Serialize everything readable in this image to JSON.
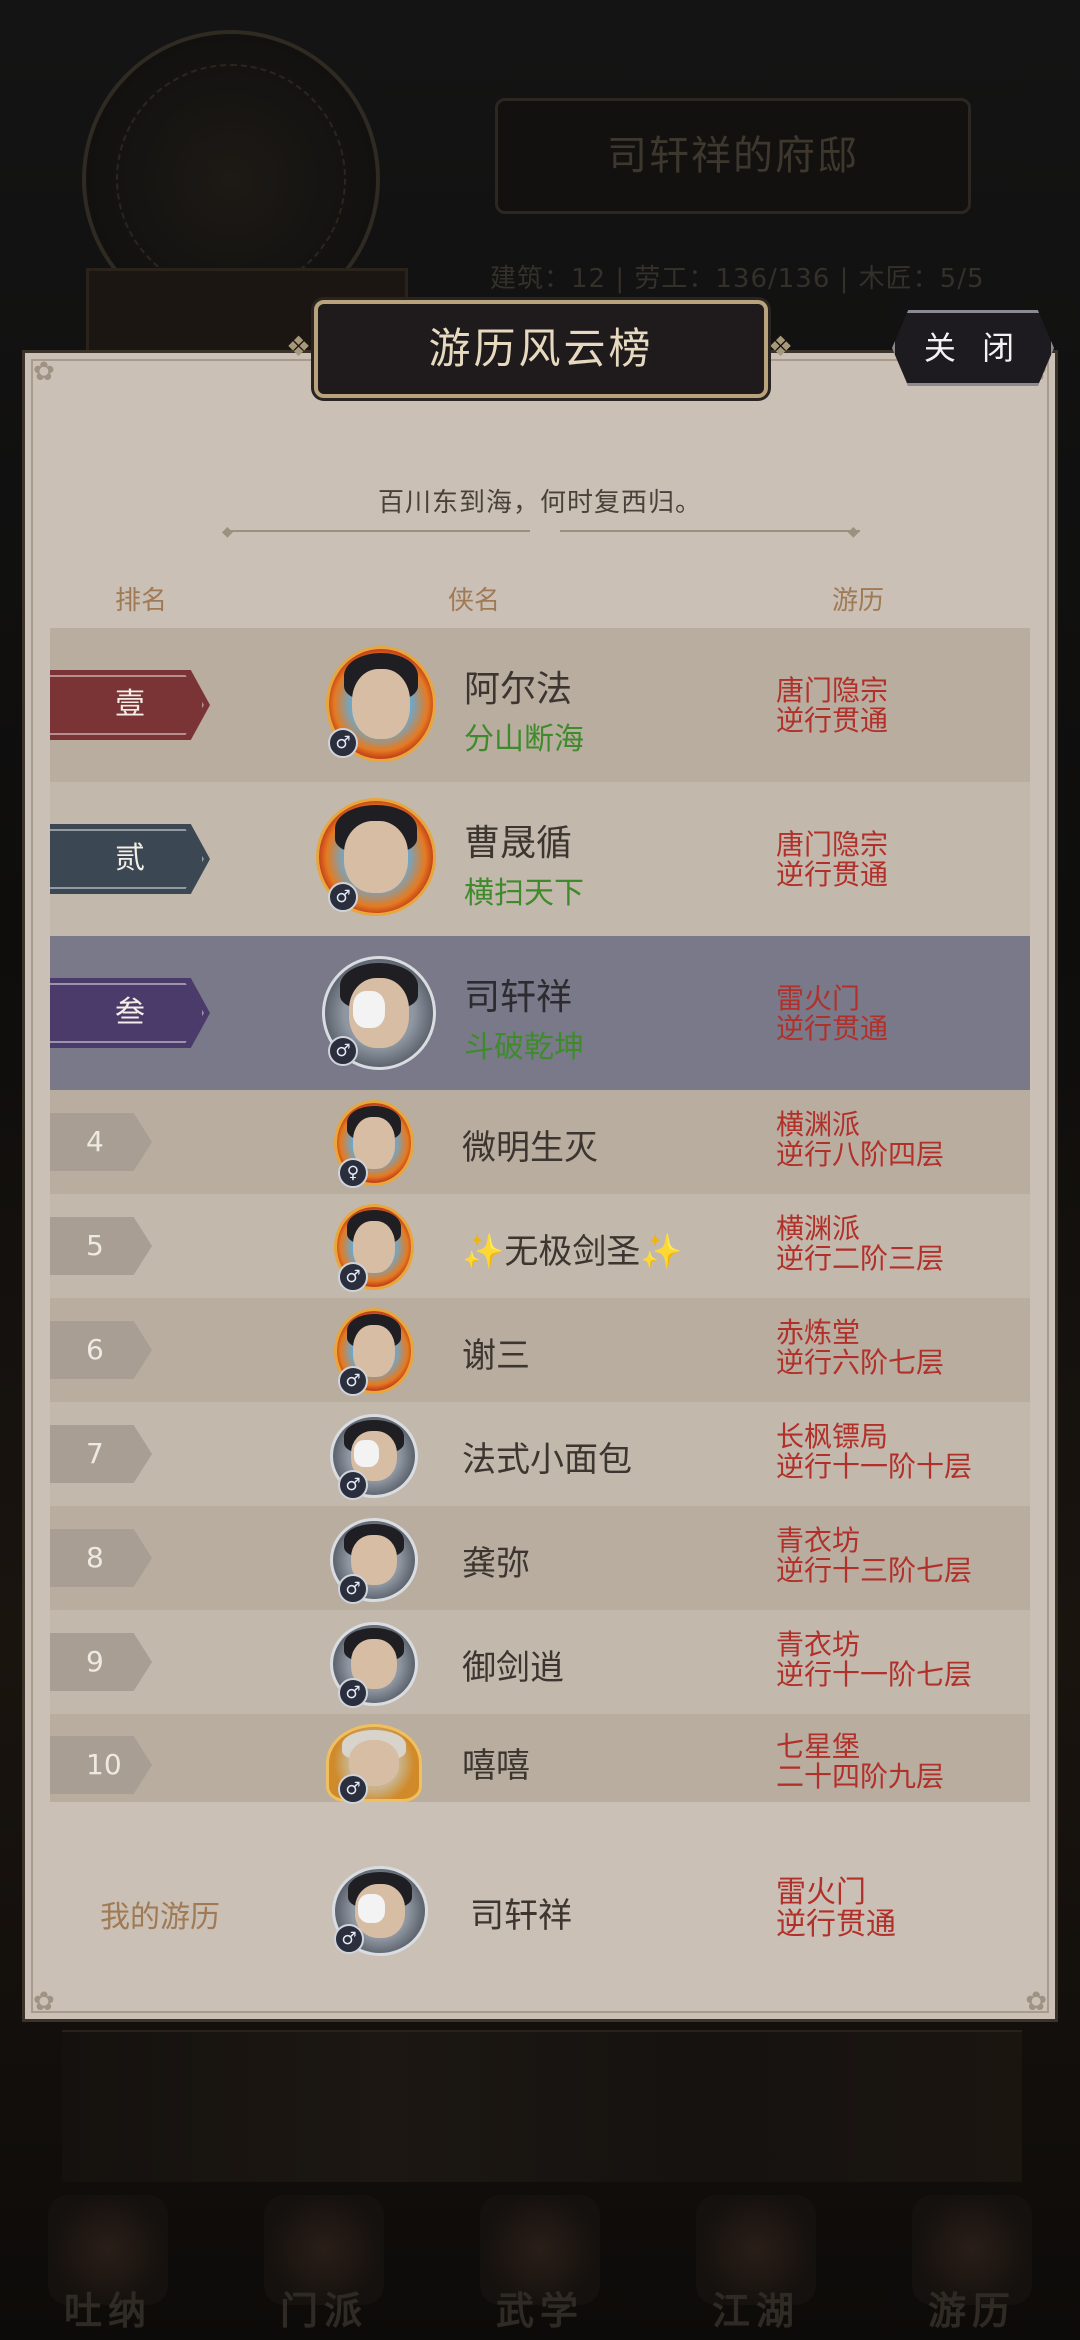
{
  "background": {
    "residence_title": "司轩祥的府邸",
    "stats": "建筑：12 | 劳工：136/136 | 木匠：5/5",
    "nav": [
      "吐纳",
      "门派",
      "武学",
      "江湖",
      "游历"
    ]
  },
  "modal": {
    "title": "游历风云榜",
    "close_label": "关 闭",
    "motto": "百川东到海，何时复西归。",
    "columns": {
      "rank": "排名",
      "name": "侠名",
      "progress": "游历"
    }
  },
  "rankings": [
    {
      "rank": "壹",
      "name": "阿尔法",
      "title": "分山断海",
      "sect": "唐门隐宗",
      "progress": "逆行贯通",
      "gender": "♂"
    },
    {
      "rank": "贰",
      "name": "曹晟循",
      "title": "横扫天下",
      "sect": "唐门隐宗",
      "progress": "逆行贯通",
      "gender": "♂"
    },
    {
      "rank": "叁",
      "name": "司轩祥",
      "title": "斗破乾坤",
      "sect": "雷火门",
      "progress": "逆行贯通",
      "gender": "♂"
    },
    {
      "rank": "4",
      "name": "微明生灭",
      "sect": "横渊派",
      "progress": "逆行八阶四层",
      "gender": "♀"
    },
    {
      "rank": "5",
      "name": "✨无极剑圣✨",
      "sect": "横渊派",
      "progress": "逆行二阶三层",
      "gender": "♂"
    },
    {
      "rank": "6",
      "name": "谢三",
      "sect": "赤炼堂",
      "progress": "逆行六阶七层",
      "gender": "♂"
    },
    {
      "rank": "7",
      "name": "法式小面包",
      "sect": "长枫镖局",
      "progress": "逆行十一阶十层",
      "gender": "♂"
    },
    {
      "rank": "8",
      "name": "龚弥",
      "sect": "青衣坊",
      "progress": "逆行十三阶七层",
      "gender": "♂"
    },
    {
      "rank": "9",
      "name": "御剑逍",
      "sect": "青衣坊",
      "progress": "逆行十一阶七层",
      "gender": "♂"
    },
    {
      "rank": "10",
      "name": "嘻嘻",
      "sect": "七星堡",
      "progress": "二十四阶九层",
      "gender": "♂"
    }
  ],
  "my_record": {
    "label": "我的游历",
    "name": "司轩祥",
    "sect": "雷火门",
    "progress": "逆行贯通",
    "gender": "♂"
  },
  "colors": {
    "panel": "#cac0b5",
    "highlight_row": "#797989",
    "sect_red": "#b1302a",
    "title_green": "#3f8b2c"
  }
}
